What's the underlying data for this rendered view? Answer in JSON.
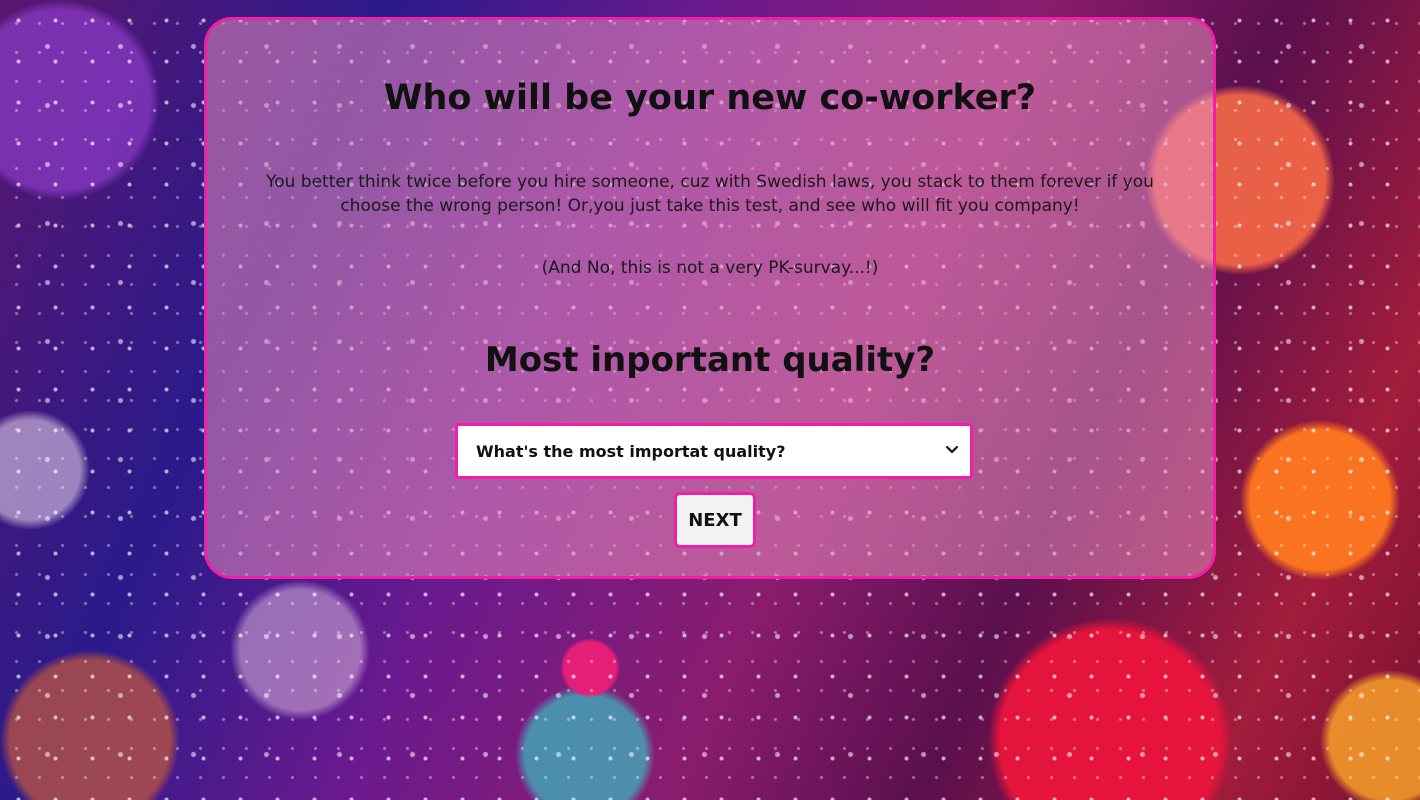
{
  "card": {
    "title": "Who will be your new co-worker?",
    "intro": "You better think twice before you hire someone, cuz with Swedish laws, you stack to them forever if you choose the wrong person! Or,you just take this test, and see who will fit you company!",
    "note": "(And No, this is not a very PK-survay...!)",
    "question": "Most inportant quality?",
    "select": {
      "selected_label": "What's the most importat quality?"
    },
    "next_label": "NEXT"
  },
  "colors": {
    "accent_border": "#f01fa8",
    "card_bg": "rgba(232,140,190,0.55)"
  },
  "icons": {
    "dropdown": "chevron-down-icon"
  }
}
